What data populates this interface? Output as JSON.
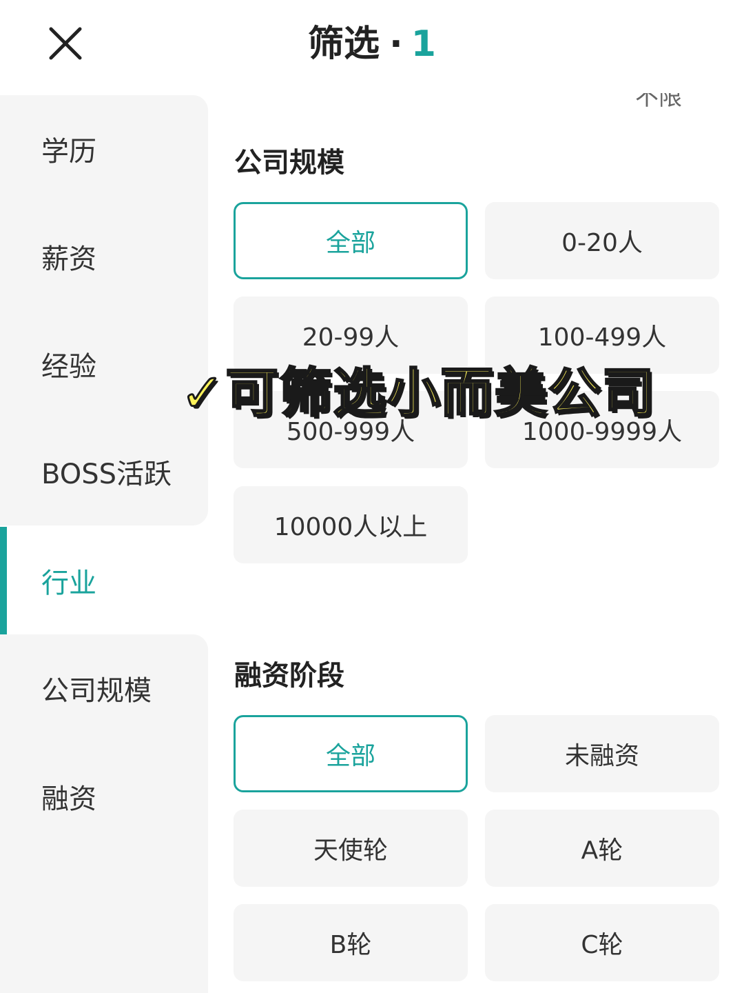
{
  "header": {
    "close_icon": "close-icon",
    "title": "筛选",
    "dot": "·",
    "count": "1"
  },
  "sidebar": {
    "items": [
      {
        "label": "学历"
      },
      {
        "label": "薪资"
      },
      {
        "label": "经验"
      },
      {
        "label": "BOSS活跃"
      },
      {
        "label": "行业",
        "active": true
      },
      {
        "label": "公司规模"
      },
      {
        "label": "融资"
      }
    ]
  },
  "content": {
    "cut_text": "不限",
    "company_size": {
      "title": "公司规模",
      "options": [
        {
          "label": "全部",
          "selected": true
        },
        {
          "label": "0-20人"
        },
        {
          "label": "20-99人"
        },
        {
          "label": "100-499人"
        },
        {
          "label": "500-999人"
        },
        {
          "label": "1000-9999人"
        },
        {
          "label": "10000人以上"
        }
      ]
    },
    "funding": {
      "title": "融资阶段",
      "options": [
        {
          "label": "全部",
          "selected": true
        },
        {
          "label": "未融资"
        },
        {
          "label": "天使轮"
        },
        {
          "label": "A轮"
        },
        {
          "label": "B轮"
        },
        {
          "label": "C轮"
        }
      ]
    }
  },
  "overlay": {
    "text": "✓可筛选小而美公司"
  },
  "colors": {
    "accent": "#1aa39c",
    "option_bg": "#f5f5f5",
    "overlay_fill": "#fff35a"
  }
}
